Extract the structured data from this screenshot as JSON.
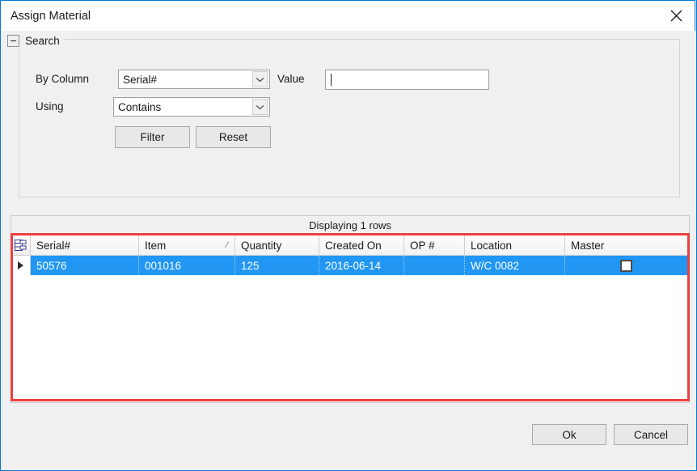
{
  "window": {
    "title": "Assign Material",
    "close_icon": "close-icon"
  },
  "search": {
    "legend": "Search",
    "collapse_icon": "minus-icon",
    "by_column_label": "By Column",
    "by_column_value": "Serial#",
    "using_label": "Using",
    "using_value": "Contains",
    "value_label": "Value",
    "value_text": "",
    "value_placeholder": "",
    "filter_button": "Filter",
    "reset_button": "Reset",
    "dropdown_icon": "chevron-down-icon"
  },
  "grid": {
    "caption": "Displaying 1 rows",
    "corner_icon": "column-chooser-icon",
    "row_indicator_icon": "row-selector-arrow-icon",
    "columns": [
      {
        "label": "Serial#",
        "sorted": ""
      },
      {
        "label": "Item",
        "sorted": "ascending"
      },
      {
        "label": "Quantity",
        "sorted": ""
      },
      {
        "label": "Created On",
        "sorted": ""
      },
      {
        "label": "OP #",
        "sorted": ""
      },
      {
        "label": "Location",
        "sorted": ""
      },
      {
        "label": "Master",
        "sorted": ""
      }
    ],
    "sort_glyph": "⁄",
    "rows": [
      {
        "serial": "50576",
        "item": "001016",
        "quantity": "125",
        "created_on": "2016-06-14",
        "op_number": "",
        "location": "W/C 0082",
        "master_checked": false
      }
    ]
  },
  "footer": {
    "ok_button": "Ok",
    "cancel_button": "Cancel"
  },
  "colors": {
    "selection_blue": "#2196f3",
    "annotation_red": "#ec4040",
    "window_frame": "#0078d7",
    "dialog_background": "#f0f0f0"
  }
}
